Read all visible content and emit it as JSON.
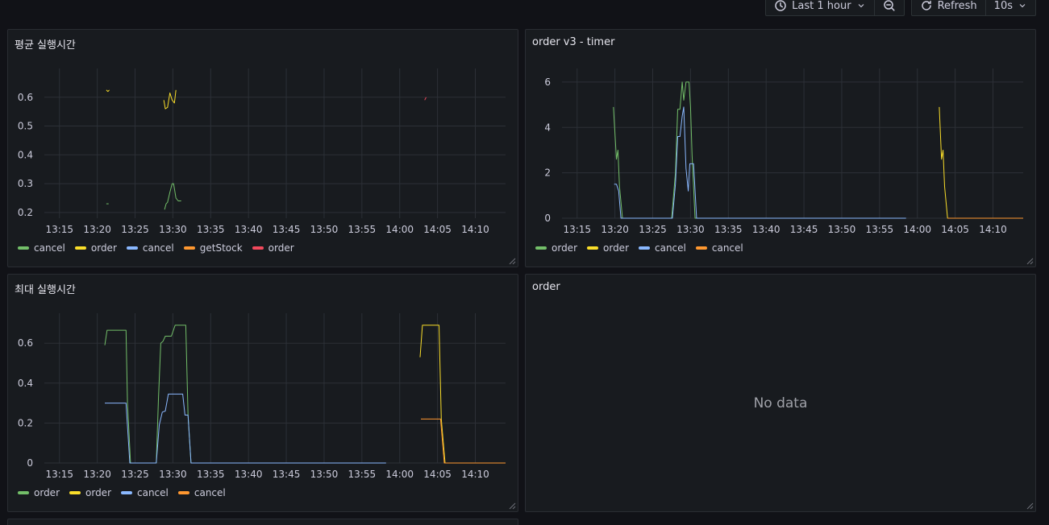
{
  "toolbar": {
    "time_range_label": "Last 1 hour",
    "refresh_label": "Refresh",
    "interval_label": "10s"
  },
  "colors": {
    "green": "#73bf69",
    "yellow": "#fade2a",
    "blue": "#8ab8ff",
    "orange": "#ff9830",
    "red": "#f2495c",
    "grid": "#2c3037",
    "tick": "#ccccdc"
  },
  "time_axis": {
    "xlim": [
      "13:13",
      "14:14"
    ],
    "ticks": [
      "13:15",
      "13:20",
      "13:25",
      "13:30",
      "13:35",
      "13:40",
      "13:45",
      "13:50",
      "13:55",
      "14:00",
      "14:05",
      "14:10"
    ]
  },
  "panels": [
    {
      "title": "평균 실행시간",
      "chart_data": {
        "type": "line",
        "ylim": [
          0.18,
          0.7
        ],
        "yticks": [
          0.2,
          0.3,
          0.4,
          0.5,
          0.6
        ],
        "series": [
          {
            "name": "cancel",
            "color": "green",
            "segments": [
              [
                [
                  "13:21.2",
                  0.23
                ],
                [
                  "13:21.5",
                  0.23
                ]
              ],
              [
                [
                  "13:28.9",
                  0.21
                ],
                [
                  "13:29.1",
                  0.23
                ],
                [
                  "13:29.3",
                  0.235
                ],
                [
                  "13:29.6",
                  0.27
                ],
                [
                  "13:29.9",
                  0.3
                ],
                [
                  "13:30.1",
                  0.3
                ],
                [
                  "13:30.4",
                  0.25
                ],
                [
                  "13:30.7",
                  0.24
                ],
                [
                  "13:31.1",
                  0.24
                ]
              ]
            ]
          },
          {
            "name": "order",
            "color": "yellow",
            "segments": [
              [
                [
                  "13:21.2",
                  0.625
                ],
                [
                  "13:21.4",
                  0.62
                ],
                [
                  "13:21.6",
                  0.625
                ]
              ],
              [
                [
                  "13:28.8",
                  0.59
                ],
                [
                  "13:29.0",
                  0.56
                ],
                [
                  "13:29.3",
                  0.565
                ],
                [
                  "13:29.6",
                  0.615
                ],
                [
                  "13:29.9",
                  0.59
                ],
                [
                  "13:30.2",
                  0.58
                ],
                [
                  "13:30.4",
                  0.625
                ]
              ]
            ]
          },
          {
            "name": "cancel",
            "color": "blue",
            "segments": []
          },
          {
            "name": "getStock",
            "color": "orange",
            "segments": []
          },
          {
            "name": "order",
            "color": "red",
            "segments": [
              [
                [
                  "14:03.3",
                  0.59
                ],
                [
                  "14:03.5",
                  0.6
                ]
              ]
            ]
          }
        ]
      }
    },
    {
      "title": "order v3 - timer",
      "chart_data": {
        "type": "line",
        "ylim": [
          0,
          6.6
        ],
        "yticks": [
          0,
          2,
          4,
          6
        ],
        "series": [
          {
            "name": "order",
            "color": "green",
            "segments": [
              [
                [
                  "13:19.8",
                  4.9
                ],
                [
                  "13:20.2",
                  2.6
                ],
                [
                  "13:20.4",
                  3.0
                ],
                [
                  "13:20.6",
                  1.4
                ],
                [
                  "13:21.0",
                  0
                ],
                [
                  "13:27.5",
                  0
                ],
                [
                  "13:28.0",
                  2.0
                ],
                [
                  "13:28.3",
                  4.8
                ],
                [
                  "13:28.6",
                  4.8
                ],
                [
                  "13:28.9",
                  6.0
                ],
                [
                  "13:29.1",
                  5.2
                ],
                [
                  "13:29.4",
                  6.0
                ],
                [
                  "13:29.8",
                  6.0
                ],
                [
                  "13:30.0",
                  4.9
                ],
                [
                  "13:30.2",
                  2.8
                ],
                [
                  "13:30.6",
                  0
                ],
                [
                  "13:31.0",
                  0
                ]
              ]
            ]
          },
          {
            "name": "order",
            "color": "yellow",
            "segments": [
              [
                [
                  "14:02.9",
                  4.9
                ],
                [
                  "14:03.2",
                  2.6
                ],
                [
                  "14:03.4",
                  3.0
                ],
                [
                  "14:03.6",
                  1.4
                ],
                [
                  "14:04.0",
                  0
                ],
                [
                  "14:14",
                  0
                ]
              ]
            ]
          },
          {
            "name": "cancel",
            "color": "blue",
            "segments": [
              [
                [
                  "13:19.9",
                  1.5
                ],
                [
                  "13:20.2",
                  1.5
                ],
                [
                  "13:20.5",
                  1.2
                ],
                [
                  "13:20.8",
                  0
                ],
                [
                  "13:27.6",
                  0
                ],
                [
                  "13:28.0",
                  1.5
                ],
                [
                  "13:28.3",
                  3.6
                ],
                [
                  "13:28.6",
                  3.6
                ],
                [
                  "13:28.9",
                  4.5
                ],
                [
                  "13:29.1",
                  4.9
                ],
                [
                  "13:29.4",
                  2.2
                ],
                [
                  "13:29.7",
                  1.2
                ],
                [
                  "13:29.9",
                  2.4
                ],
                [
                  "13:30.4",
                  2.4
                ],
                [
                  "13:30.8",
                  0
                ],
                [
                  "13:58.5",
                  0
                ]
              ]
            ]
          },
          {
            "name": "cancel",
            "color": "orange",
            "segments": [
              [
                [
                  "14:04.0",
                  0
                ],
                [
                  "14:14",
                  0
                ]
              ]
            ]
          }
        ]
      }
    },
    {
      "title": "최대 실행시간",
      "chart_data": {
        "type": "line",
        "ylim": [
          0,
          0.75
        ],
        "yticks": [
          0,
          0.2,
          0.4,
          0.6
        ],
        "series": [
          {
            "name": "order",
            "color": "green",
            "segments": [
              [
                [
                  "13:21.0",
                  0.59
                ],
                [
                  "13:21.3",
                  0.665
                ],
                [
                  "13:23.8",
                  0.665
                ],
                [
                  "13:24.0",
                  0.3
                ],
                [
                  "13:24.4",
                  0
                ],
                [
                  "13:27.8",
                  0
                ],
                [
                  "13:28.1",
                  0.33
                ],
                [
                  "13:28.4",
                  0.6
                ],
                [
                  "13:28.7",
                  0.61
                ],
                [
                  "13:29.0",
                  0.635
                ],
                [
                  "13:29.8",
                  0.635
                ],
                [
                  "13:30.3",
                  0.69
                ],
                [
                  "13:31.7",
                  0.69
                ],
                [
                  "13:32.0",
                  0.24
                ],
                [
                  "13:32.4",
                  0
                ],
                [
                  "13:58.0",
                  0
                ]
              ]
            ]
          },
          {
            "name": "order",
            "color": "yellow",
            "segments": [
              [
                [
                  "14:02.7",
                  0.53
                ],
                [
                  "14:03.0",
                  0.69
                ],
                [
                  "14:05.2",
                  0.69
                ],
                [
                  "14:05.5",
                  0.22
                ],
                [
                  "14:06.0",
                  0
                ],
                [
                  "14:14",
                  0
                ]
              ]
            ]
          },
          {
            "name": "cancel",
            "color": "blue",
            "segments": [
              [
                [
                  "13:21.0",
                  0.3
                ],
                [
                  "13:23.8",
                  0.3
                ],
                [
                  "13:24.3",
                  0
                ],
                [
                  "13:27.8",
                  0
                ],
                [
                  "13:28.2",
                  0.19
                ],
                [
                  "13:28.6",
                  0.255
                ],
                [
                  "13:29.0",
                  0.26
                ],
                [
                  "13:29.4",
                  0.345
                ],
                [
                  "13:31.3",
                  0.345
                ],
                [
                  "13:31.6",
                  0.24
                ],
                [
                  "13:32.0",
                  0.24
                ],
                [
                  "13:32.4",
                  0
                ],
                [
                  "13:58.2",
                  0
                ]
              ]
            ]
          },
          {
            "name": "cancel",
            "color": "orange",
            "segments": [
              [
                [
                  "14:02.8",
                  0.22
                ],
                [
                  "14:05.4",
                  0.22
                ],
                [
                  "14:05.9",
                  0
                ],
                [
                  "14:14",
                  0
                ]
              ]
            ]
          }
        ]
      }
    },
    {
      "title": "order",
      "no_data_text": "No data"
    }
  ]
}
